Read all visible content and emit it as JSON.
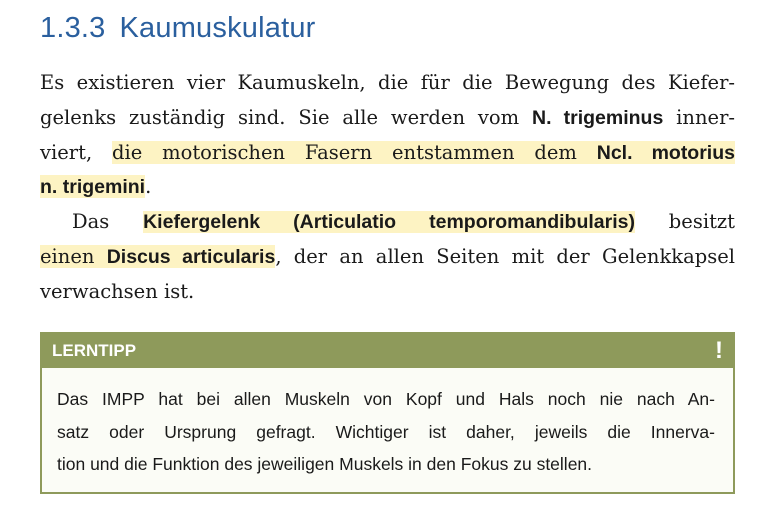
{
  "section": {
    "number": "1.3.3",
    "title": "Kaumuskulatur"
  },
  "paragraph1": {
    "l1": "Es existieren vier Kaumuskeln, die für die Bewegung des Kiefer-",
    "l2_a": "gelenks zuständig sind. Sie alle werden vom ",
    "l2_b": "N. trigeminus",
    "l2_c": " inner-",
    "l3_a": "viert, ",
    "l3_b": "die motorischen Fasern entstammen dem ",
    "l3_c": "Ncl. motorius",
    "l4_a": "n. trigemini",
    "l4_b": "."
  },
  "paragraph2": {
    "l1_a": "Das ",
    "l1_b": "Kiefergelenk (Articulatio temporomandibularis)",
    "l1_c": " besitzt",
    "l2_a": "einen ",
    "l2_b": "Discus articularis",
    "l2_c": ", der an allen Seiten mit der Gelenkkapsel",
    "l3": "verwachsen ist."
  },
  "lerntipp": {
    "label": "LERNTIPP",
    "icon": "!",
    "icon_name": "exclamation-icon",
    "lines": [
      "Das IMPP hat bei allen Muskeln von Kopf und Hals noch nie nach An-",
      "satz oder Ursprung gefragt. Wichtiger ist daher, jeweils die Innerva-",
      "tion und die Funktion des jeweiligen Muskels in den Fokus zu stellen."
    ],
    "colors": {
      "header": "#8e9a5b",
      "background": "#fbfcf6"
    }
  },
  "colors": {
    "heading": "#2a5f9e",
    "highlight": "#fdf3c3",
    "text": "#1a1a1a"
  }
}
